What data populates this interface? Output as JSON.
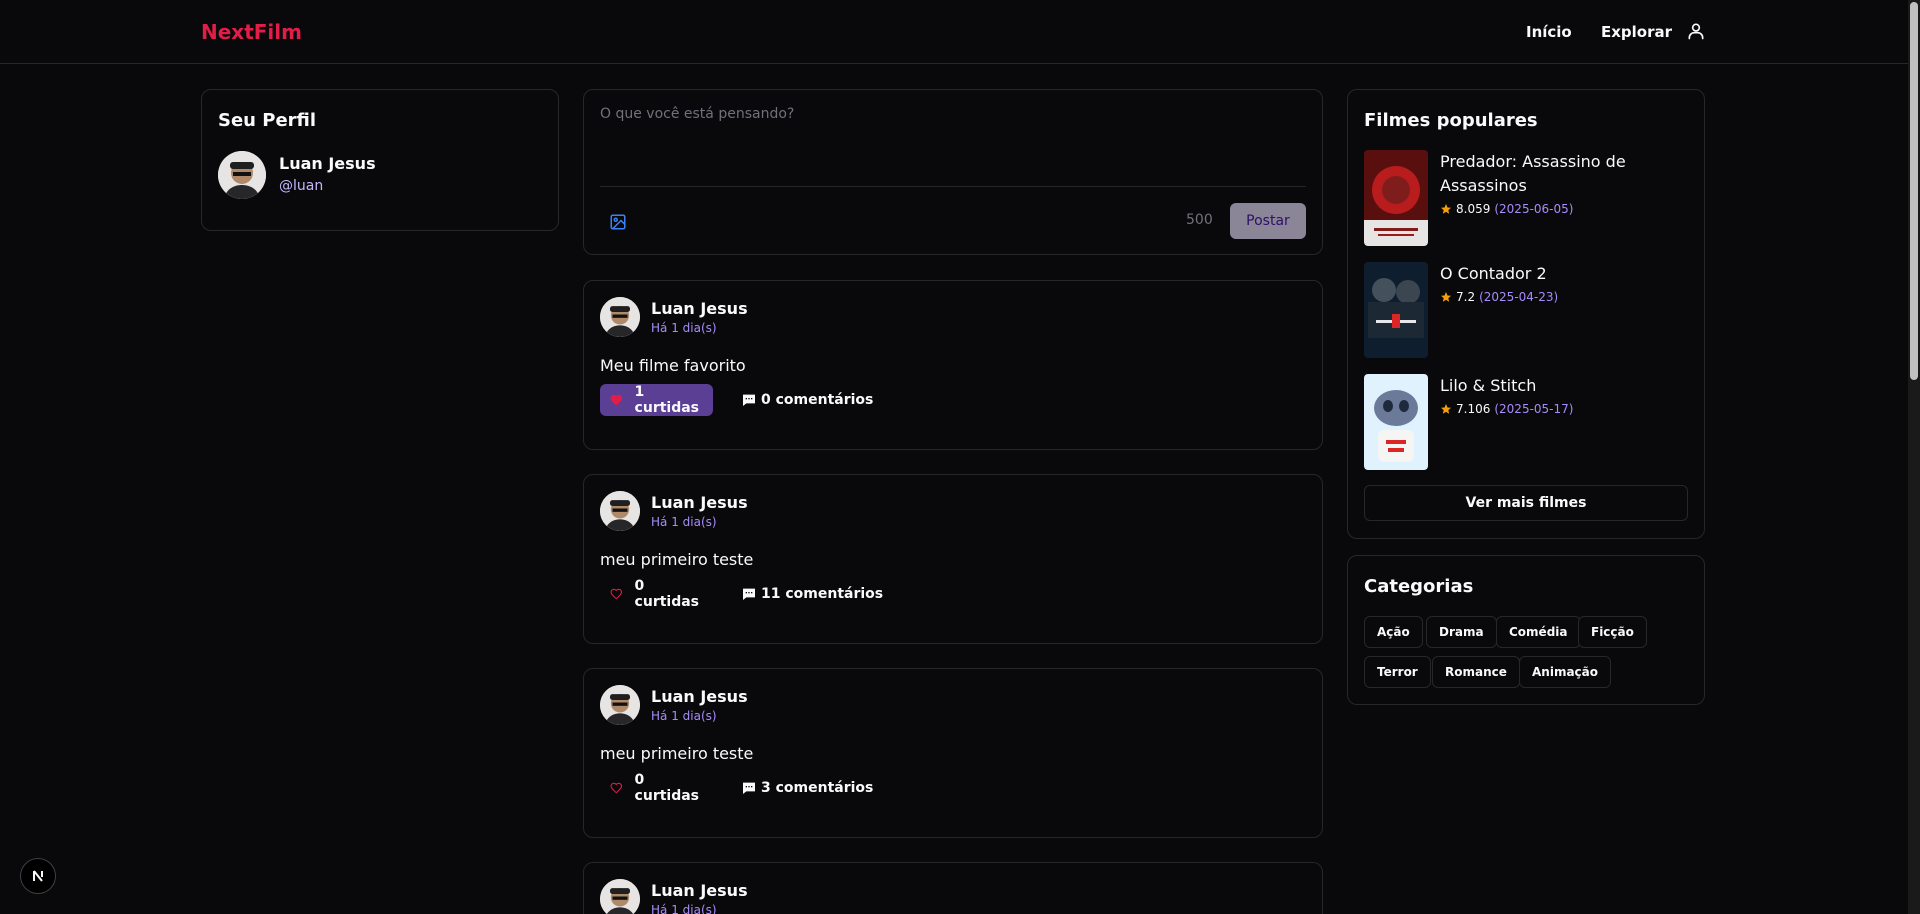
{
  "header": {
    "logo": "NextFilm",
    "nav_home": "Início",
    "nav_explore": "Explorar"
  },
  "profile": {
    "title": "Seu Perfil",
    "name": "Luan Jesus",
    "handle": "@luan"
  },
  "composer": {
    "placeholder": "O que você está pensando?",
    "char_count": "500",
    "post_label": "Postar"
  },
  "posts": [
    {
      "author": "Luan Jesus",
      "time": "Há 1 dia(s)",
      "text": "Meu filme favorito",
      "likes": "1 curtidas",
      "comments": "0 comentários",
      "liked": true
    },
    {
      "author": "Luan Jesus",
      "time": "Há 1 dia(s)",
      "text": "meu primeiro teste",
      "likes": "0 curtidas",
      "comments": "11 comentários",
      "liked": false
    },
    {
      "author": "Luan Jesus",
      "time": "Há 1 dia(s)",
      "text": "meu primeiro teste",
      "likes": "0 curtidas",
      "comments": "3 comentários",
      "liked": false
    },
    {
      "author": "Luan Jesus",
      "time": "Há 1 dia(s)"
    }
  ],
  "popular": {
    "title": "Filmes populares",
    "films": [
      {
        "title": "Predador: Assassino de Assassinos",
        "rating": "8.059",
        "date": "(2025-06-05)"
      },
      {
        "title": "O Contador 2",
        "rating": "7.2",
        "date": "(2025-04-23)"
      },
      {
        "title": "Lilo & Stitch",
        "rating": "7.106",
        "date": "(2025-05-17)"
      }
    ],
    "more_label": "Ver mais filmes"
  },
  "categories": {
    "title": "Categorias",
    "items": [
      "Ação",
      "Drama",
      "Comédia",
      "Ficção",
      "Terror",
      "Romance",
      "Animação"
    ]
  },
  "colors": {
    "accent": "#e11d48",
    "purple": "#a78bfa",
    "like_bg": "#5b3f95",
    "star": "#f59e0b"
  },
  "icons": {
    "user": "user-icon",
    "image": "image-icon",
    "heart": "heart-icon",
    "comment": "comment-icon",
    "star": "star-icon"
  }
}
